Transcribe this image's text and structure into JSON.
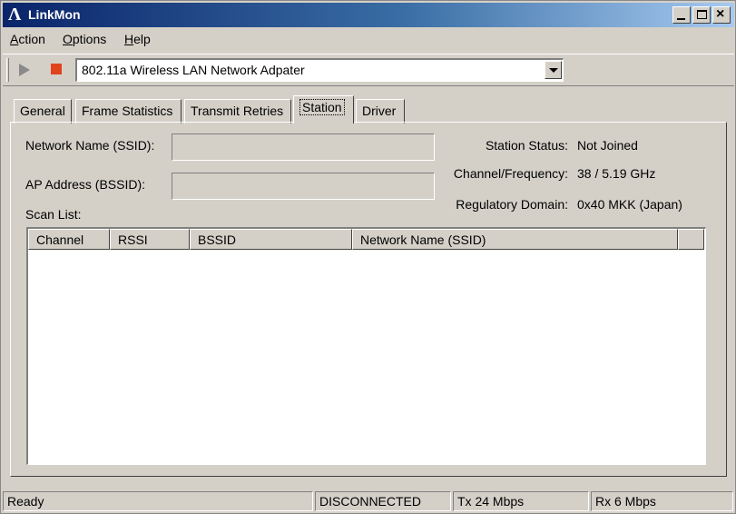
{
  "window": {
    "title": "LinkMon",
    "logo_glyph": "Λ"
  },
  "title_buttons": {
    "close_glyph": "×"
  },
  "menu": {
    "items": [
      {
        "accel": "A",
        "rest": "ction"
      },
      {
        "accel": "O",
        "rest": "ptions"
      },
      {
        "accel": "H",
        "rest": "elp"
      }
    ]
  },
  "toolbar": {
    "adapter_selected": "802.11a Wireless LAN Network Adpater"
  },
  "tabs": [
    {
      "label": "General"
    },
    {
      "label": "Frame Statistics"
    },
    {
      "label": "Transmit Retries"
    },
    {
      "label": "Station",
      "active": true
    },
    {
      "label": "Driver"
    }
  ],
  "station": {
    "ssid_label": "Network Name (SSID):",
    "ssid_value": "",
    "bssid_label": "AP Address (BSSID):",
    "bssid_value": "",
    "status_label": "Station Status:",
    "status_value": "Not Joined",
    "channel_label": "Channel/Frequency:",
    "channel_value": "38 / 5.19 GHz",
    "domain_label": "Regulatory Domain:",
    "domain_value": "0x40 MKK (Japan)",
    "scan_list_label": "Scan List:"
  },
  "scan_list": {
    "columns": [
      "Channel",
      "RSSI",
      "BSSID",
      "Network Name (SSID)"
    ],
    "rows": []
  },
  "statusbar": {
    "ready": "Ready",
    "connection": "DISCONNECTED",
    "tx": "Tx 24 Mbps",
    "rx": "Rx 6 Mbps"
  },
  "colors": {
    "stop_icon": "#e0441c",
    "title_gradient_start": "#0a246a",
    "face": "#d4d0c8"
  }
}
